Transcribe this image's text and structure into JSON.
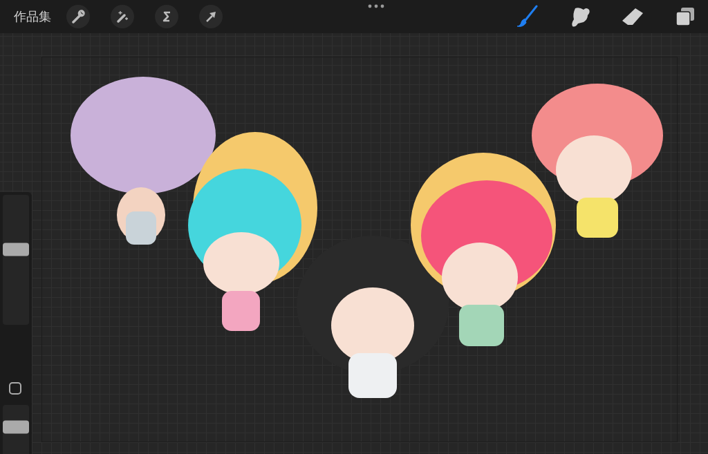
{
  "top_bar": {
    "gallery_label": "作品集",
    "right_tools": [
      {
        "kind": "brush",
        "selected": true
      },
      {
        "kind": "smudge",
        "selected": false
      },
      {
        "kind": "eraser",
        "selected": false
      },
      {
        "kind": "layers",
        "selected": false
      }
    ]
  },
  "sidebar": {
    "size_slider": {
      "level": 0.58
    },
    "opacity_slider": {
      "level": 0.73
    }
  }
}
